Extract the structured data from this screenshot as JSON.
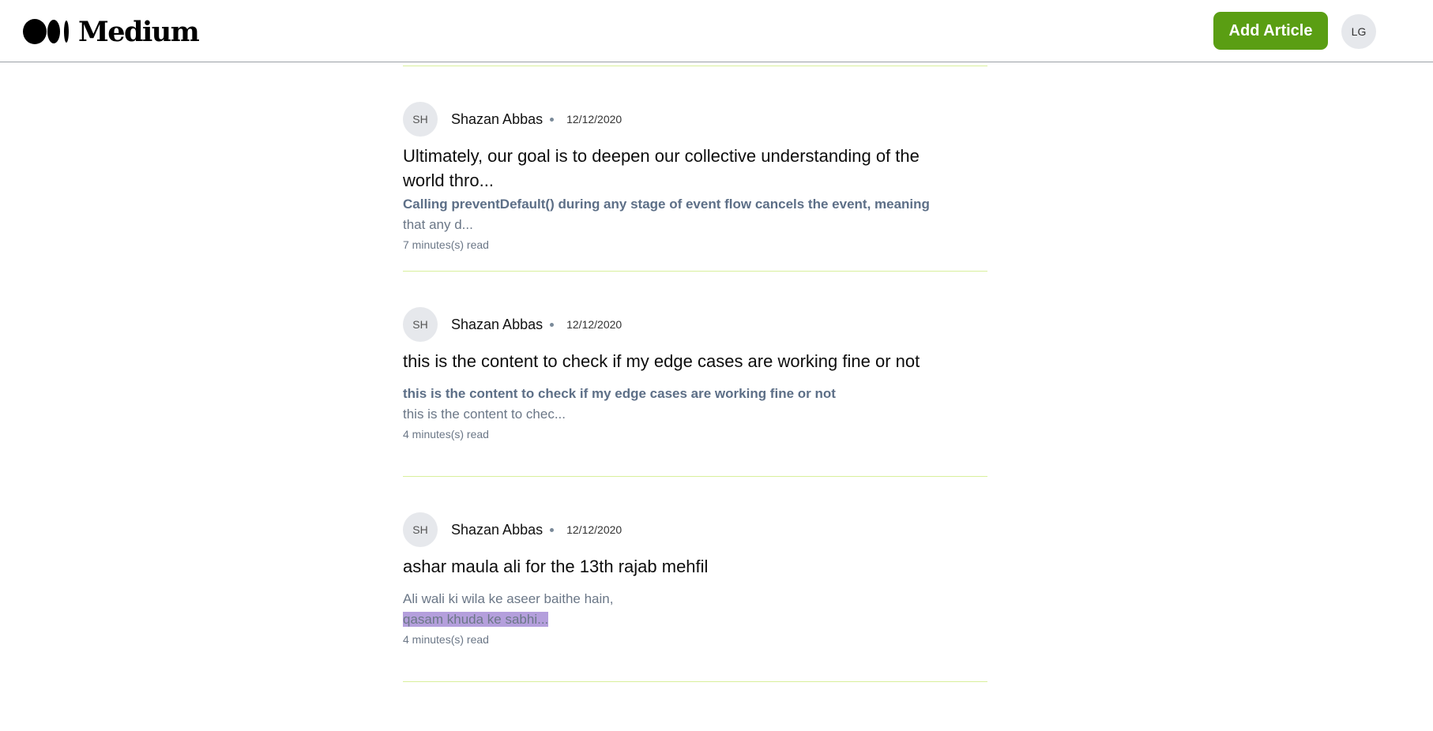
{
  "header": {
    "brand": "Medium",
    "add_label": "Add Article",
    "user_initials": "LG",
    "accent_color": "#5a9e13"
  },
  "articles": [
    {
      "avatar_initials": "SH",
      "author": "Shazan Abbas",
      "date": "12/12/2020",
      "title": "Ultimately, our goal is to deepen our collective understanding of the world thro...",
      "excerpt_lead": "Calling preventDefault() during any stage of event flow cancels the event, meaning",
      "excerpt_rest": "that any d...",
      "read_time": "7 minutes(s) read"
    },
    {
      "avatar_initials": "SH",
      "author": "Shazan Abbas",
      "date": "12/12/2020",
      "title": "this is the content to check if my edge cases are working fine or not",
      "excerpt_lead": "this is the content to check if my edge cases are working fine or not",
      "excerpt_rest": "this is the content to chec...",
      "read_time": "4 minutes(s) read"
    },
    {
      "avatar_initials": "SH",
      "author": "Shazan Abbas",
      "date": "12/12/2020",
      "title": "ashar maula ali for the 13th rajab mehfil",
      "excerpt_line1": "Ali wali ki wila ke aseer baithe hain,",
      "excerpt_line2_selected": "qasam khuda ke sabhi...",
      "read_time": "4 minutes(s) read"
    }
  ]
}
